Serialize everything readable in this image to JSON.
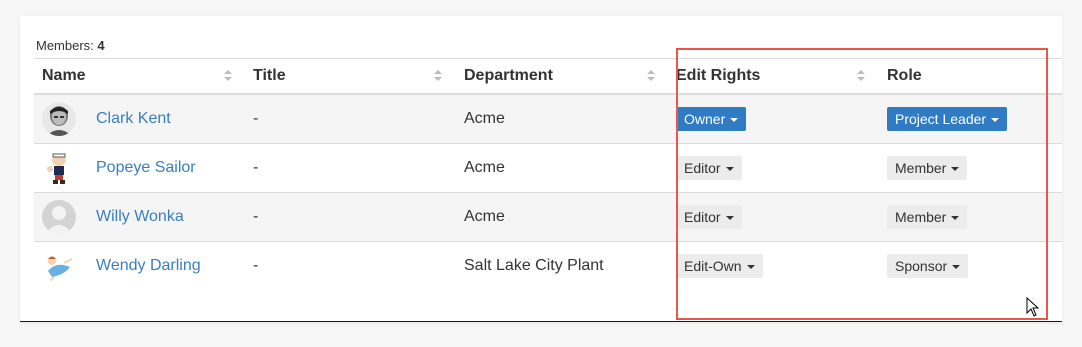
{
  "summary": {
    "members_label": "Members:",
    "members_count": "4"
  },
  "columns": {
    "name": "Name",
    "title": "Title",
    "department": "Department",
    "edit_rights": "Edit Rights",
    "role": "Role"
  },
  "rows": [
    {
      "name": "Clark Kent",
      "title": "-",
      "department": "Acme",
      "edit_rights": "Owner",
      "edit_rights_style": "primary",
      "role": "Project Leader",
      "role_style": "primary",
      "avatar": "photo-avatar"
    },
    {
      "name": "Popeye Sailor",
      "title": "-",
      "department": "Acme",
      "edit_rights": "Editor",
      "edit_rights_style": "default",
      "role": "Member",
      "role_style": "default",
      "avatar": "cartoon-avatar"
    },
    {
      "name": "Willy Wonka",
      "title": "-",
      "department": "Acme",
      "edit_rights": "Editor",
      "edit_rights_style": "default",
      "role": "Member",
      "role_style": "default",
      "avatar": "default-avatar"
    },
    {
      "name": "Wendy Darling",
      "title": "-",
      "department": "Salt Lake City Plant",
      "edit_rights": "Edit-Own",
      "edit_rights_style": "default",
      "role": "Sponsor",
      "role_style": "default",
      "avatar": "cartoon-avatar"
    }
  ],
  "colors": {
    "link": "#3a7ec2",
    "primary_button": "#2f7bc4",
    "default_button": "#ececec",
    "highlight_box": "#e8564c"
  }
}
